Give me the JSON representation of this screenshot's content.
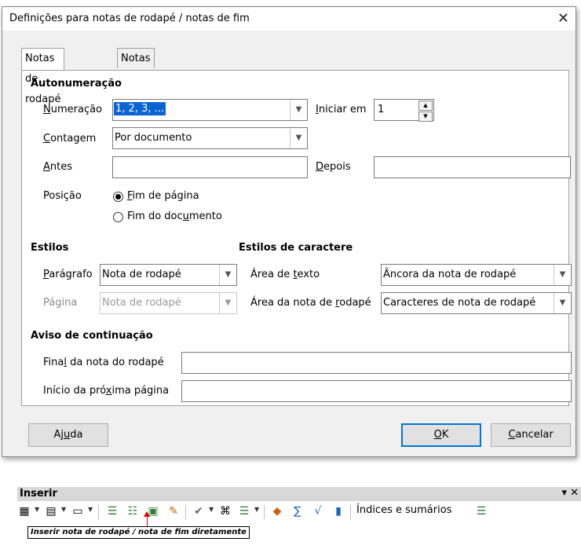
{
  "dialog": {
    "title": "Definições para notas de rodapé / notas de fim",
    "close_glyph": "✕",
    "tabs": [
      {
        "label": "Notas de rodapé"
      },
      {
        "label": "Notas de fim"
      }
    ],
    "autonumeracao": {
      "heading": "Autonumeração",
      "numeracao_label": "Numeração",
      "numeracao_value": "1, 2, 3, ...",
      "iniciar_label": "Iniciar em",
      "iniciar_value": "1",
      "contagem_label": "Contagem",
      "contagem_value": "Por documento",
      "antes_label": "Antes",
      "antes_value": "",
      "depois_label": "Depois",
      "depois_value": "",
      "posicao_label": "Posição",
      "posicao_options": [
        "Fim de página",
        "Fim do documento"
      ],
      "posicao_selected": "Fim de página"
    },
    "estilos": {
      "heading": "Estilos",
      "paragrafo_label": "Parágrafo",
      "paragrafo_value": "Nota de rodapé",
      "pagina_label": "Página",
      "pagina_value": "Nota de rodapé"
    },
    "estilos_caractere": {
      "heading": "Estilos de caractere",
      "area_texto_label": "Área de texto",
      "area_texto_value": "Âncora da nota de rodapé",
      "area_nota_label": "Área da nota de rodapé",
      "area_nota_value": "Caracteres de nota de rodapé"
    },
    "aviso": {
      "heading": "Aviso de continuação",
      "final_label": "Final da nota do rodapé",
      "final_value": "",
      "inicio_label": "Início da próxima página",
      "inicio_value": ""
    },
    "buttons": {
      "help": "Ajuda",
      "ok": "OK",
      "cancel": "Cancelar"
    }
  },
  "toolbar": {
    "title": "Inserir",
    "controls": "▾ ✕",
    "indices_label": "Índices e sumários"
  },
  "callout": {
    "text": "Inserir nota de rodapé / nota de fim diretamente",
    "color": "#e00000"
  },
  "colors": {
    "selection": "#0a64d4",
    "default_button_border": "#0078d7"
  }
}
